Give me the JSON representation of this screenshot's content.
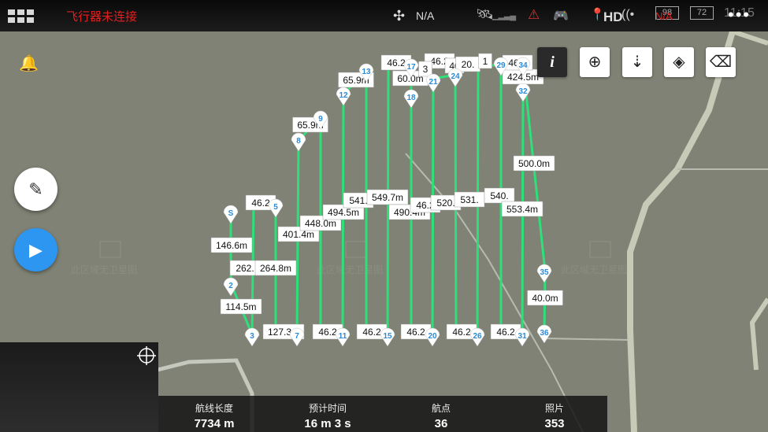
{
  "topbar": {
    "connection_status": "飞行器未连接",
    "drone_icon": "drone-icon",
    "drone_status": "N/A",
    "hd_label": "HD",
    "battery1": "98",
    "battery2": "72",
    "battery_status": "N/A",
    "time": "11:15"
  },
  "toolbar": {
    "icons": [
      "info-icon",
      "locate-icon",
      "compass-lock-icon",
      "layers-icon",
      "eraser-icon"
    ]
  },
  "left_controls": {
    "icons": [
      "bell-icon",
      "edit-icon",
      "play-icon"
    ]
  },
  "map": {
    "watermark": "此区域无卫星图"
  },
  "waypoints": [
    {
      "id": "S",
      "label": "S"
    },
    {
      "id": "2",
      "label": "2"
    },
    {
      "id": "3",
      "label": "3"
    },
    {
      "id": "5",
      "label": "5"
    },
    {
      "id": "7",
      "label": "7"
    },
    {
      "id": "8",
      "label": "8"
    },
    {
      "id": "9",
      "label": "9"
    },
    {
      "id": "11",
      "label": "11"
    },
    {
      "id": "12",
      "label": "12"
    },
    {
      "id": "13",
      "label": "13"
    },
    {
      "id": "15",
      "label": "15"
    },
    {
      "id": "17",
      "label": "17"
    },
    {
      "id": "18",
      "label": "18"
    },
    {
      "id": "20",
      "label": "20"
    },
    {
      "id": "21",
      "label": "21"
    },
    {
      "id": "24",
      "label": "24"
    },
    {
      "id": "26",
      "label": "26"
    },
    {
      "id": "29",
      "label": "29"
    },
    {
      "id": "31",
      "label": "31"
    },
    {
      "id": "32",
      "label": "32"
    },
    {
      "id": "34",
      "label": "34"
    },
    {
      "id": "35",
      "label": "35"
    },
    {
      "id": "36",
      "label": "36"
    }
  ],
  "segment_labels": [
    "146.6m",
    "262.",
    "264.8m",
    "114.5m",
    "46.2",
    "401.4m",
    "448.0m",
    "65.9m",
    "494.5m",
    "541.",
    "65.9m",
    "549.7m",
    "490.4m",
    "60.0m",
    "46.2",
    "520.",
    "531.",
    "540.",
    "553.4m",
    "500.0m",
    "424.5m",
    "40.0m",
    "127.3m",
    "46.2",
    "46.2",
    "46.2",
    "46.2",
    "46.2",
    "46.2",
    "46.2",
    "40",
    "20.",
    "1",
    "46.2",
    "3"
  ],
  "stats": [
    {
      "label": "航线长度",
      "value": "7734 m"
    },
    {
      "label": "预计时间",
      "value": "16 m 3 s"
    },
    {
      "label": "航点",
      "value": "36"
    },
    {
      "label": "照片",
      "value": "353"
    }
  ]
}
